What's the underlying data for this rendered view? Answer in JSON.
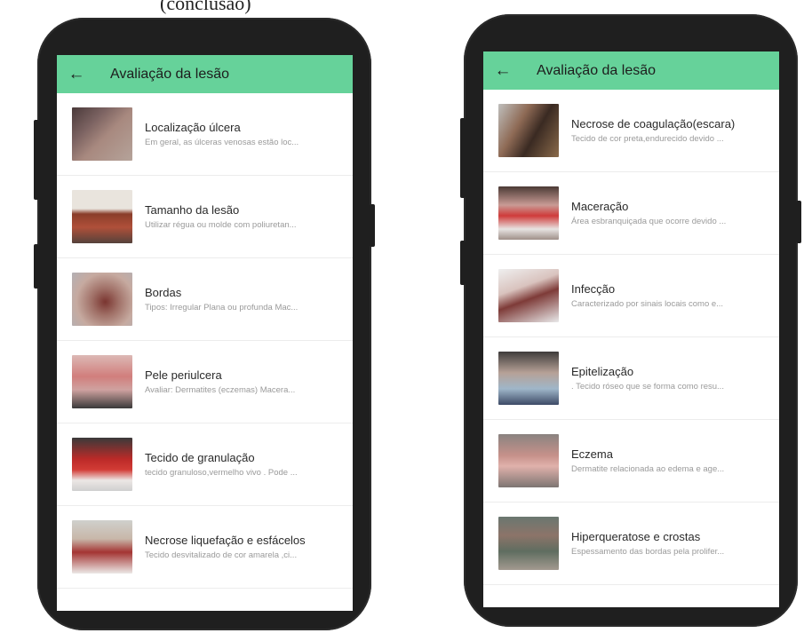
{
  "caption": "(conclusão)",
  "screens": [
    {
      "appbar": {
        "back_icon": "arrow-left-icon",
        "title": "Avaliação da lesão"
      },
      "items": [
        {
          "title": "Localização úlcera",
          "subtitle": "Em geral, as úlceras venosas estão loc..."
        },
        {
          "title": "Tamanho da lesão",
          "subtitle": "Utilizar régua ou molde com poliuretan..."
        },
        {
          "title": "Bordas",
          "subtitle": "Tipos: Irregular Plana ou profunda Mac..."
        },
        {
          "title": "Pele periulcera",
          "subtitle": "Avaliar: Dermatites (eczemas) Macera..."
        },
        {
          "title": "Tecido de granulação",
          "subtitle": "tecido granuloso,vermelho vivo . Pode ..."
        },
        {
          "title": "Necrose liquefação e esfácelos",
          "subtitle": "Tecido desvitalizado de cor amarela ,ci..."
        }
      ]
    },
    {
      "appbar": {
        "back_icon": "arrow-left-icon",
        "title": "Avaliação da lesão"
      },
      "items": [
        {
          "title": "Necrose de coagulação(escara)",
          "subtitle": "Tecido de cor preta,endurecido devido ..."
        },
        {
          "title": "Maceração",
          "subtitle": "Área esbranquiçada que ocorre devido ..."
        },
        {
          "title": "Infecção",
          "subtitle": "Caracterizado por sinais locais como e..."
        },
        {
          "title": "Epitelização",
          "subtitle": ". Tecido róseo que se forma como resu..."
        },
        {
          "title": "Eczema",
          "subtitle": "Dermatite relacionada ao edema e age..."
        },
        {
          "title": "Hiperqueratose e crostas",
          "subtitle": "Espessamento das bordas pela prolifer..."
        }
      ]
    }
  ],
  "colors": {
    "appbar": "#66d29a",
    "phone_frame": "#1f1f1f"
  }
}
